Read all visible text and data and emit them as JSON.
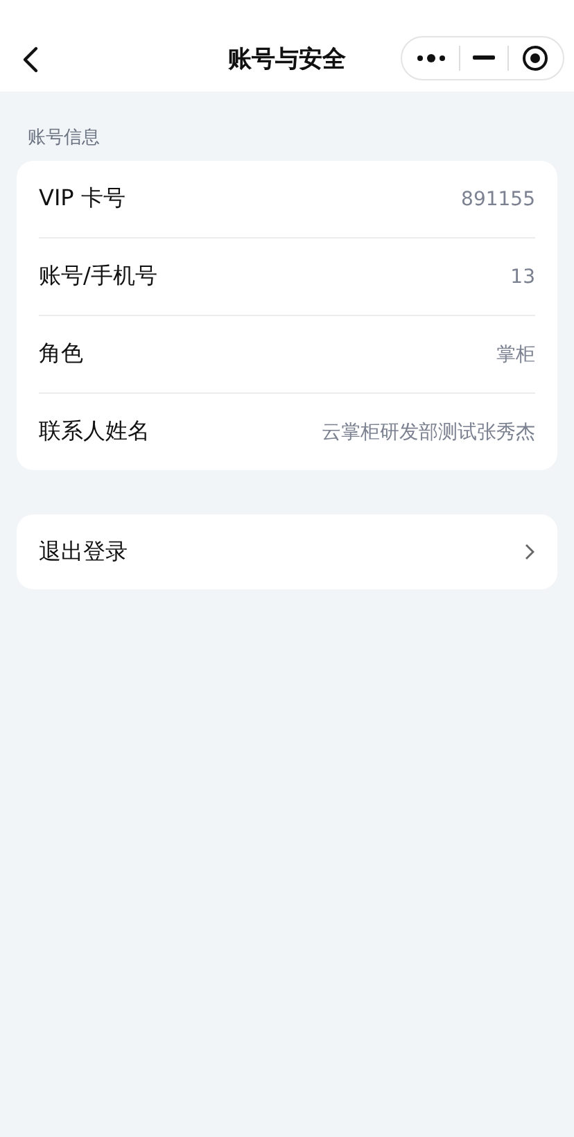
{
  "nav_bar": {
    "title": "账号与安全"
  },
  "section": {
    "title": "账号信息",
    "rows": [
      {
        "label": "VIP 卡号",
        "value": "891155"
      },
      {
        "label": "账号/手机号",
        "value": "13"
      },
      {
        "label": "角色",
        "value": "掌柜"
      },
      {
        "label": "联系人姓名",
        "value": "云掌柜研发部测试张秀杰"
      }
    ]
  },
  "logout": {
    "label": "退出登录"
  }
}
